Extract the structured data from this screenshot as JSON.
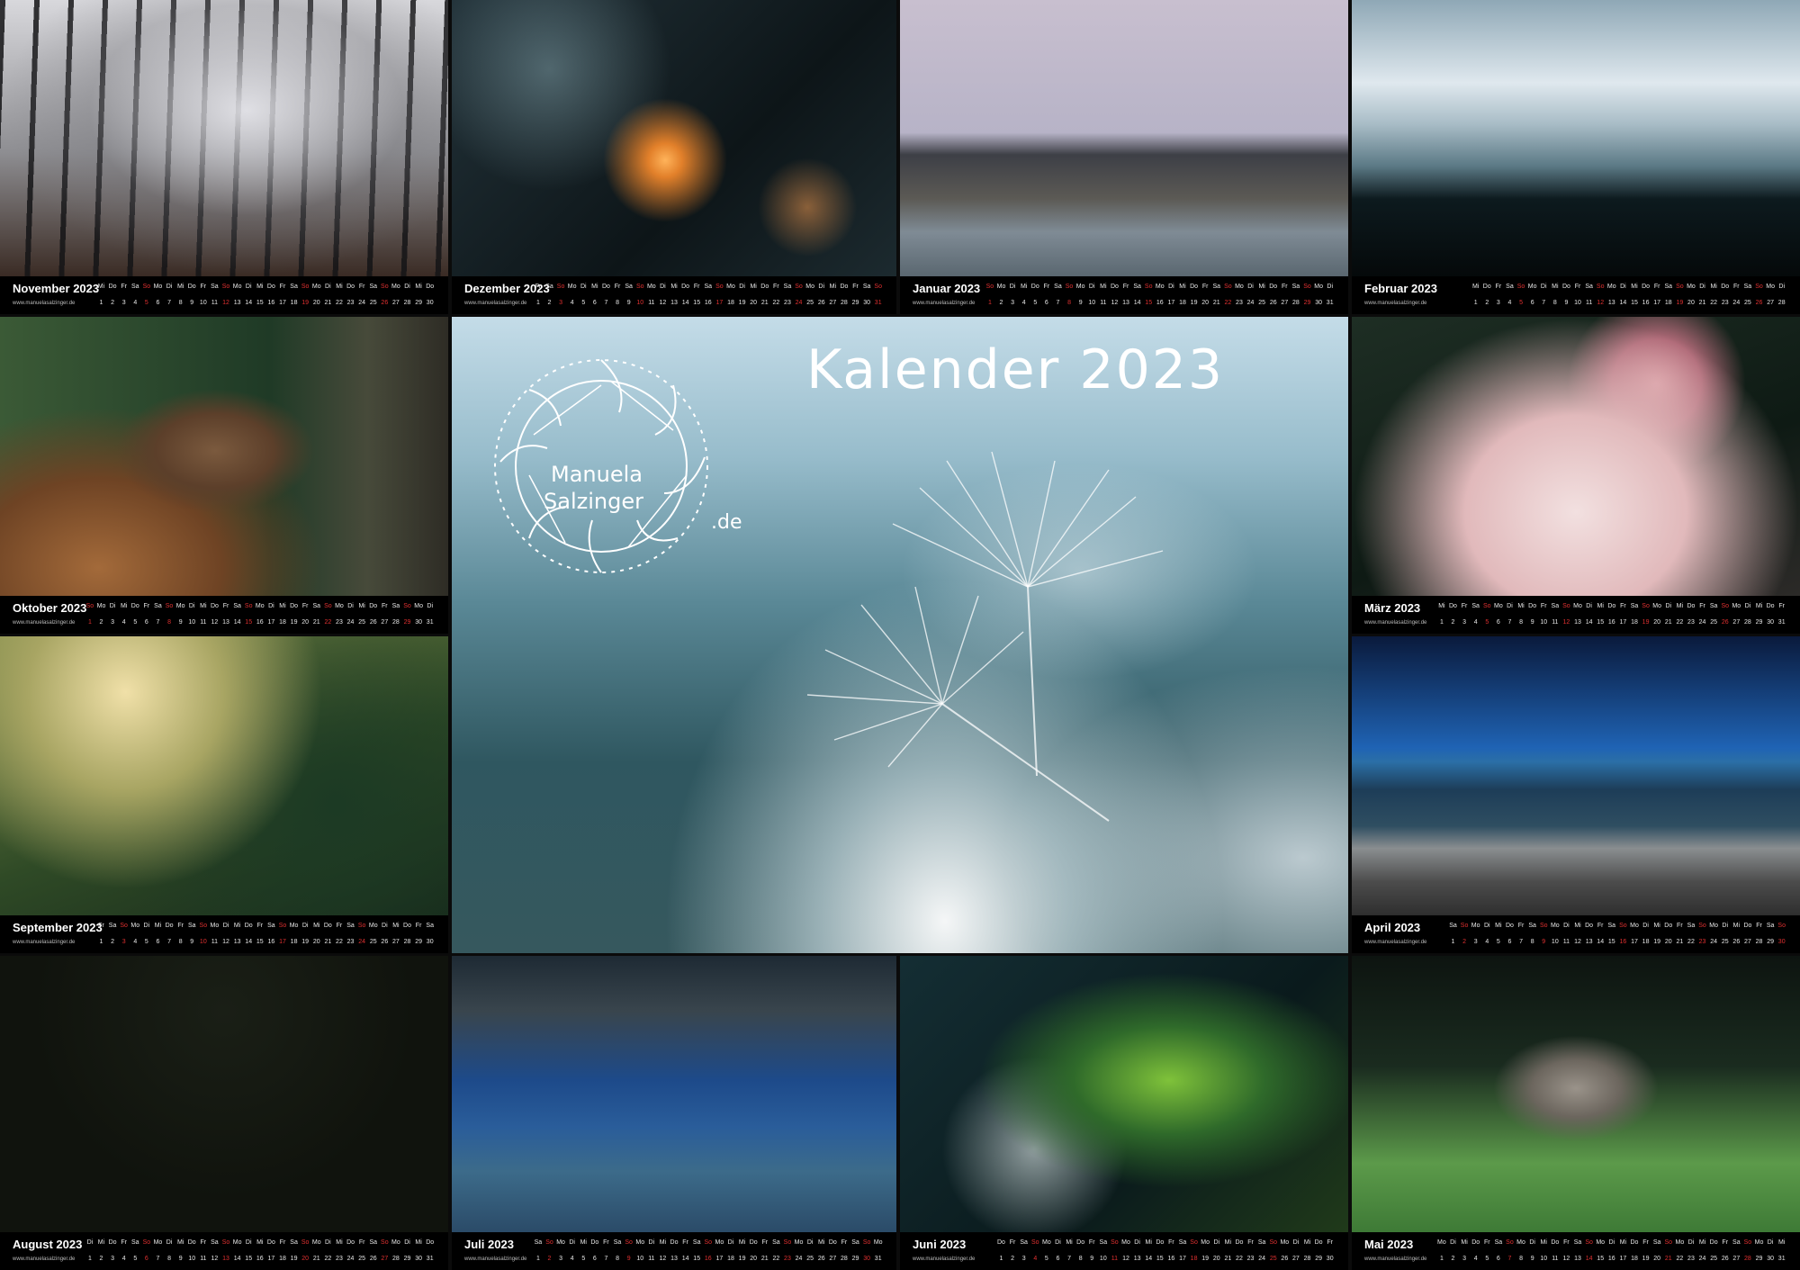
{
  "title": "Kalender 2023",
  "logo": {
    "line1": "Manuela",
    "line2": "Salzinger",
    "suffix": ".de"
  },
  "website": "www.manuelasalzinger.de",
  "colors": {
    "strip": "#000000",
    "text": "#ffffff",
    "sunday": "#e03030"
  },
  "months": [
    {
      "id": "nov",
      "name": "November 2023",
      "start": "Mi",
      "days": 30
    },
    {
      "id": "dec",
      "name": "Dezember 2023",
      "start": "Fr",
      "days": 31
    },
    {
      "id": "jan",
      "name": "Januar 2023",
      "start": "So",
      "days": 31
    },
    {
      "id": "feb",
      "name": "Februar 2023",
      "start": "Mi",
      "days": 28
    },
    {
      "id": "oct",
      "name": "Oktober 2023",
      "start": "So",
      "days": 31
    },
    {
      "id": "mar",
      "name": "März 2023",
      "start": "Mi",
      "days": 31
    },
    {
      "id": "sep",
      "name": "September 2023",
      "start": "Fr",
      "days": 30
    },
    {
      "id": "apr",
      "name": "April 2023",
      "start": "Sa",
      "days": 30
    },
    {
      "id": "aug",
      "name": "August 2023",
      "start": "Di",
      "days": 31
    },
    {
      "id": "jul",
      "name": "Juli 2023",
      "start": "Sa",
      "days": 31
    },
    {
      "id": "jun",
      "name": "Juni 2023",
      "start": "Do",
      "days": 30
    },
    {
      "id": "may",
      "name": "Mai 2023",
      "start": "Mo",
      "days": 31
    }
  ],
  "weekdays": [
    "Mo",
    "Di",
    "Mi",
    "Do",
    "Fr",
    "Sa",
    "So"
  ]
}
